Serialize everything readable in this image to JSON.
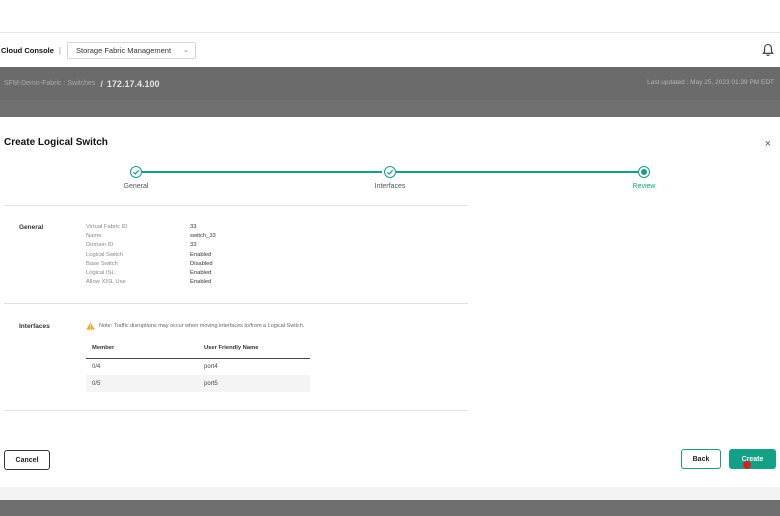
{
  "app": {
    "name": "Cloud Console",
    "separator": "|",
    "module_select": "Storage Fabric Management"
  },
  "breadcrumb": {
    "parent": "SFM-Demo-Fabric : Switches",
    "separator": "/",
    "current": "172.17.4.100"
  },
  "last_updated": "Last updated : May 25, 2023 01:39 PM EDT",
  "modal": {
    "title": "Create Logical Switch",
    "close_symbol": "×",
    "steps": [
      {
        "label": "General",
        "state": "complete"
      },
      {
        "label": "Interfaces",
        "state": "complete"
      },
      {
        "label": "Review",
        "state": "current"
      }
    ],
    "general": {
      "label": "General",
      "fields": [
        {
          "key": "Virtual Fabric ID",
          "value": "33"
        },
        {
          "key": "Name",
          "value": "switch_33"
        },
        {
          "key": "Domain ID",
          "value": "33"
        },
        {
          "key": "Logical Switch",
          "value": "Enabled"
        },
        {
          "key": "Base Switch",
          "value": "Disabled"
        },
        {
          "key": "Logical ISL",
          "value": "Enabled"
        },
        {
          "key": "Allow XISL Use",
          "value": "Enabled"
        }
      ]
    },
    "interfaces": {
      "label": "Interfaces",
      "warning": "Note: Traffic disruptions may occur when moving interfaces to/from a Logical Switch.",
      "columns": [
        "Member",
        "User Friendly Name"
      ],
      "rows": [
        [
          "0/4",
          "port4"
        ],
        [
          "0/5",
          "port5"
        ]
      ]
    },
    "buttons": {
      "cancel": "Cancel",
      "back": "Back",
      "create": "Create"
    }
  },
  "colors": {
    "accent": "#13a085",
    "header_bg": "#6b6b6b",
    "warning": "#f5a623"
  },
  "icons": {
    "bell": "bell-icon",
    "check": "check-icon",
    "warning": "warning-icon",
    "close": "close-icon",
    "chevron": "chevron-down-icon"
  }
}
